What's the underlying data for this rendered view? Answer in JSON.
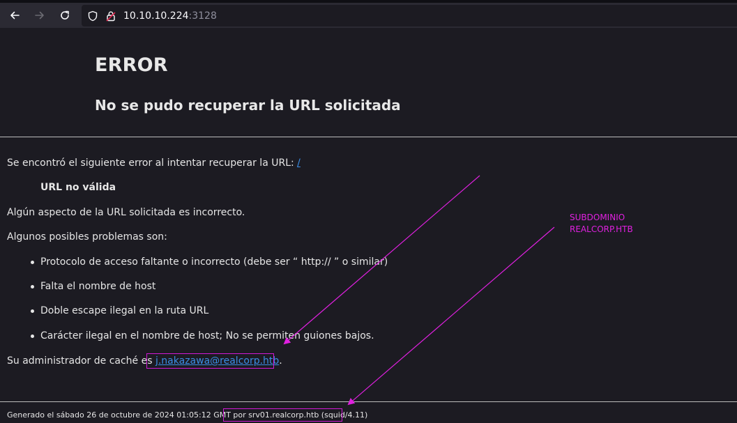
{
  "browser": {
    "url_host": "10.10.10.224",
    "url_port": ":3128"
  },
  "page": {
    "title": "ERROR",
    "subtitle": "No se pudo recuperar la URL solicitada",
    "intro_text": "Se encontró el siguiente error al intentar recuperar la URL: ",
    "intro_link": "/",
    "error_name": "URL no válida",
    "description": "Algún aspecto de la URL solicitada es incorrecto.",
    "problems_heading": "Algunos posibles problemas son:",
    "problems": [
      "Protocolo de acceso faltante o incorrecto (debe ser “ http:// ” o similar)",
      "Falta el nombre de host",
      "Doble escape ilegal en la ruta URL",
      "Carácter ilegal en el nombre de host; No se permiten guiones bajos."
    ],
    "admin_text": "Su administrador de caché es ",
    "admin_email": "j.nakazawa@realcorp.htb",
    "admin_suffix": ".",
    "footer_prefix": "Generado el sábado 26 de octubre de 2024 01:05:12 GMT por ",
    "footer_server": "srv01.realcorp.htb (squid/4.11)"
  },
  "annotation": {
    "line1": "SUBDOMINIO",
    "line2": "REALCORP.HTB",
    "color": "#e020e0"
  },
  "icons": [
    "back-arrow-icon",
    "forward-arrow-icon",
    "reload-icon",
    "shield-icon",
    "lock-icon"
  ]
}
